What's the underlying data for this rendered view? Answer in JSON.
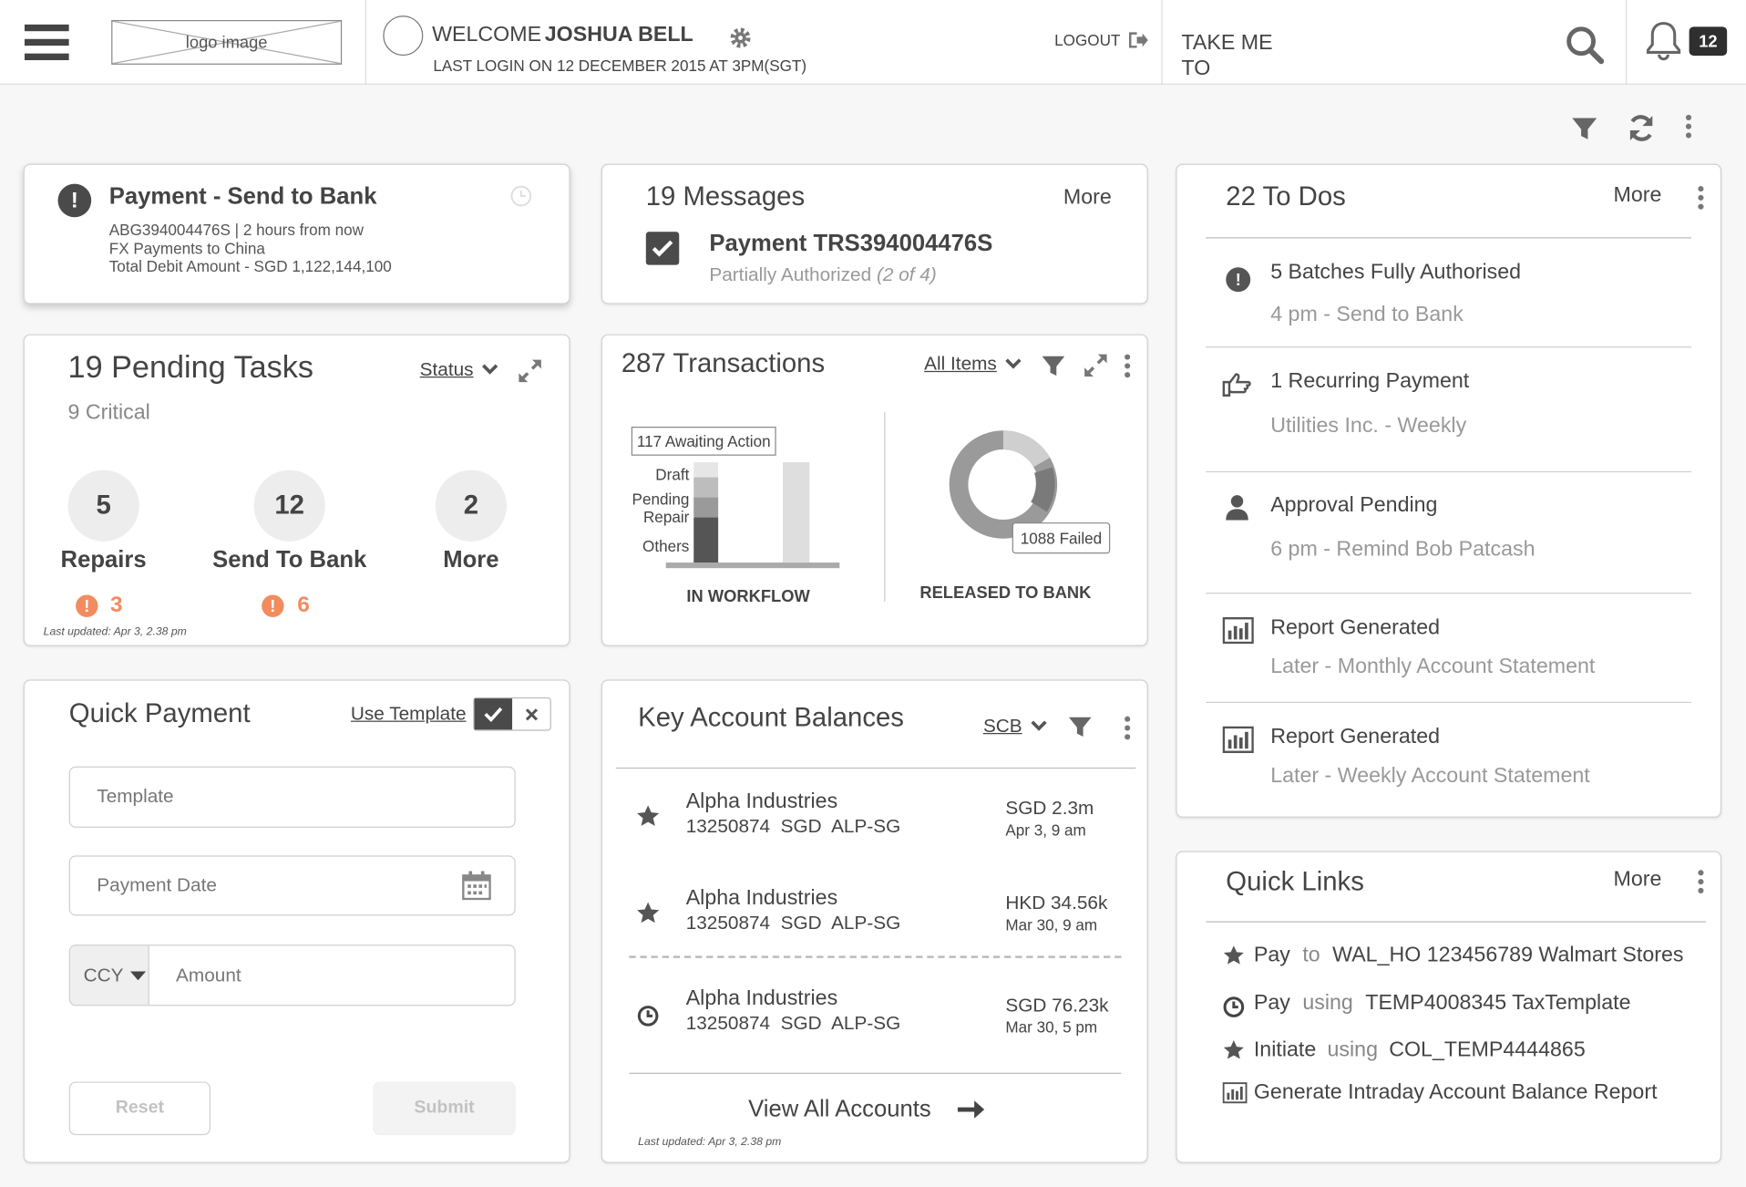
{
  "header": {
    "logo": "logo image",
    "welcome_prefix": "WELCOME",
    "user_name": "JOSHUA BELL",
    "last_login": "LAST LOGIN ON 12 DECEMBER 2015 AT 3PM(SGT)",
    "logout": "LOGOUT",
    "take_me_to_1": "TAKE ME",
    "take_me_to_2": "TO",
    "notification_count": "12"
  },
  "alert": {
    "title": "Payment - Send to Bank",
    "ref": "ABG394004476S | 2 hours from now",
    "desc": "FX Payments to China",
    "amount": "Total Debit Amount  - SGD 1,122,144,100"
  },
  "messages": {
    "title": "19 Messages",
    "more": "More",
    "item_title": "Payment TRS394004476S",
    "item_status": "Partially Authorized",
    "item_count": "(2 of 4)"
  },
  "todos": {
    "title": "22 To Dos",
    "more": "More",
    "items": [
      {
        "title": "5 Batches Fully Authorised",
        "sub": "4 pm - Send to Bank"
      },
      {
        "title": "1 Recurring Payment",
        "sub": "Utilities Inc. - Weekly"
      },
      {
        "title": "Approval Pending",
        "sub": "6 pm - Remind Bob Patcash"
      },
      {
        "title": "Report Generated",
        "sub": "Later - Monthly Account Statement"
      },
      {
        "title": "Report Generated",
        "sub": "Later - Weekly Account Statement"
      }
    ]
  },
  "pending": {
    "title": "19 Pending Tasks",
    "status": "Status",
    "critical": "9 Critical",
    "stats": [
      {
        "count": "5",
        "label": "Repairs",
        "warn": "3"
      },
      {
        "count": "12",
        "label": "Send To Bank",
        "warn": "6"
      },
      {
        "count": "2",
        "label": "More"
      }
    ],
    "last_updated": "Last updated: Apr 3, 2.38 pm"
  },
  "transactions": {
    "title": "287 Transactions",
    "filter": "All Items",
    "awaiting": "117 Awaiting Action",
    "legend": [
      "Draft",
      "Pending",
      "Repair",
      "Others"
    ],
    "in_workflow": "IN WORKFLOW",
    "failed": "1088 Failed",
    "released": "RELEASED TO BANK"
  },
  "quick_payment": {
    "title": "Quick Payment",
    "use_template": "Use Template",
    "template_ph": "Template",
    "date_ph": "Payment Date",
    "ccy": "CCY",
    "amount_ph": "Amount",
    "reset": "Reset",
    "submit": "Submit"
  },
  "balances": {
    "title": "Key Account Balances",
    "bank": "SCB",
    "rows": [
      {
        "name": "Alpha Industries",
        "acct": "13250874  SGD  ALP-SG",
        "amount": "SGD 2.3m",
        "date": "Apr 3, 9 am",
        "icon": "star-icon"
      },
      {
        "name": "Alpha Industries",
        "acct": "13250874  SGD  ALP-SG",
        "amount": "HKD 34.56k",
        "date": "Mar 30, 9 am",
        "icon": "star-icon"
      },
      {
        "name": "Alpha Industries",
        "acct": "13250874  SGD  ALP-SG",
        "amount": "SGD 76.23k",
        "date": "Mar 30, 5 pm",
        "icon": "clock-icon"
      }
    ],
    "view_all": "View All Accounts",
    "last_updated": "Last updated: Apr 3, 2.38 pm"
  },
  "quick_links": {
    "title": "Quick Links",
    "more": "More",
    "links": [
      {
        "a": "Pay",
        "b": "to",
        "c": "WAL_HO 123456789 Walmart Stores"
      },
      {
        "a": "Pay",
        "b": "using",
        "c": "TEMP4008345 TaxTemplate"
      },
      {
        "a": "Initiate",
        "b": "using",
        "c": "COL_TEMP4444865"
      },
      {
        "a": "Generate Intraday Account Balance Report",
        "b": "",
        "c": ""
      }
    ]
  },
  "chart_data": {
    "type": "bar",
    "title": "287 Transactions",
    "categories": [
      "IN WORKFLOW"
    ],
    "series": [
      {
        "name": "Draft",
        "values": [
          0.15
        ]
      },
      {
        "name": "Pending",
        "values": [
          0.2
        ]
      },
      {
        "name": "Repair",
        "values": [
          0.2
        ]
      },
      {
        "name": "Others",
        "values": [
          0.45
        ]
      }
    ]
  }
}
